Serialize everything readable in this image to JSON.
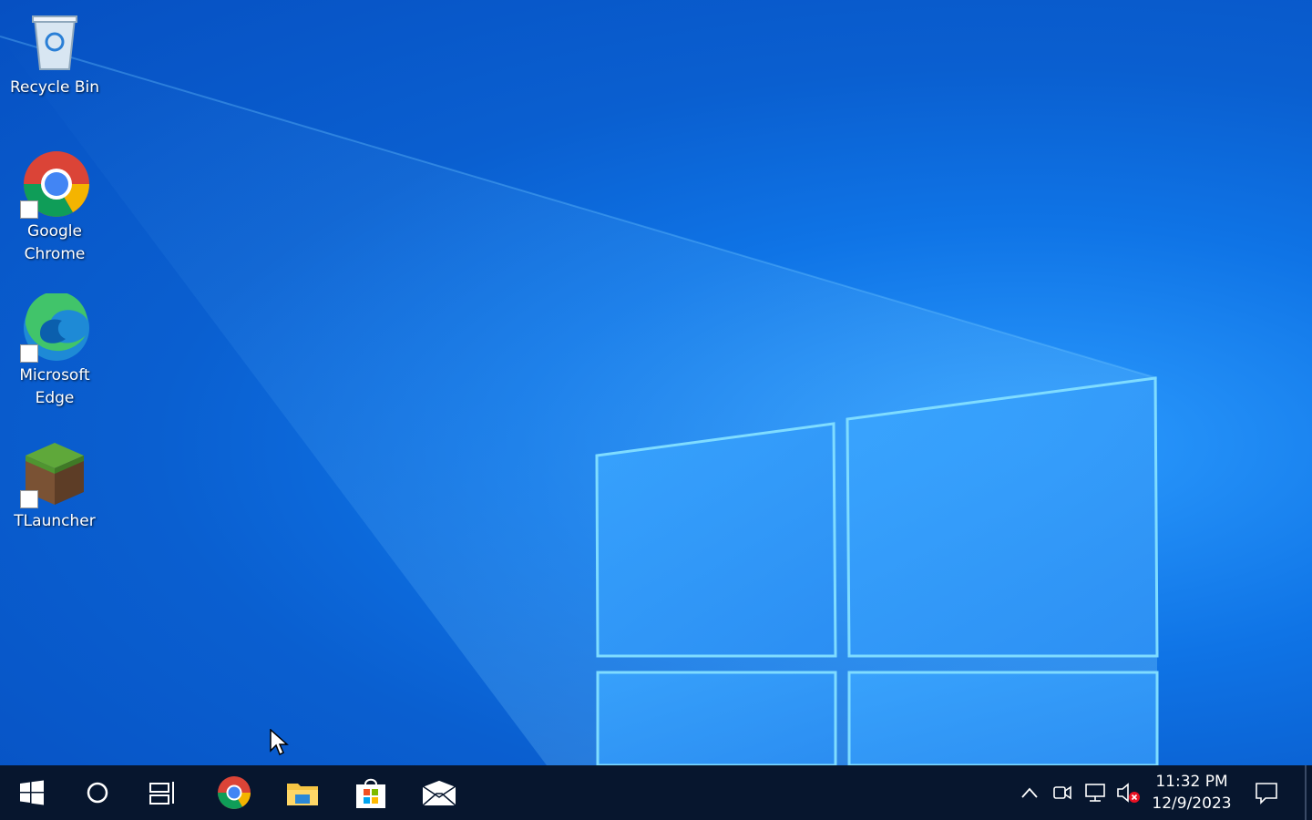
{
  "desktop": {
    "icons": [
      {
        "label": "Recycle Bin",
        "icon": "recycle-bin-icon"
      },
      {
        "label": "Google Chrome",
        "icon": "chrome-icon"
      },
      {
        "label": "Microsoft Edge",
        "icon": "edge-icon"
      },
      {
        "label": "TLauncher",
        "icon": "tlauncher-icon"
      }
    ]
  },
  "taskbar": {
    "apps": [
      {
        "icon": "start-icon"
      },
      {
        "icon": "search-cortana-icon"
      },
      {
        "icon": "task-view-icon"
      },
      {
        "icon": "chrome-icon"
      },
      {
        "icon": "file-explorer-icon"
      },
      {
        "icon": "microsoft-store-icon"
      },
      {
        "icon": "mail-icon"
      }
    ],
    "tray": {
      "icons": [
        "chevron-up-icon",
        "meet-now-icon",
        "network-icon",
        "volume-muted-icon"
      ],
      "time": "11:32 PM",
      "date": "12/9/2023"
    }
  },
  "colors": {
    "taskbar_bg": "#07162e",
    "desktop_blue": "#0f74e6"
  }
}
